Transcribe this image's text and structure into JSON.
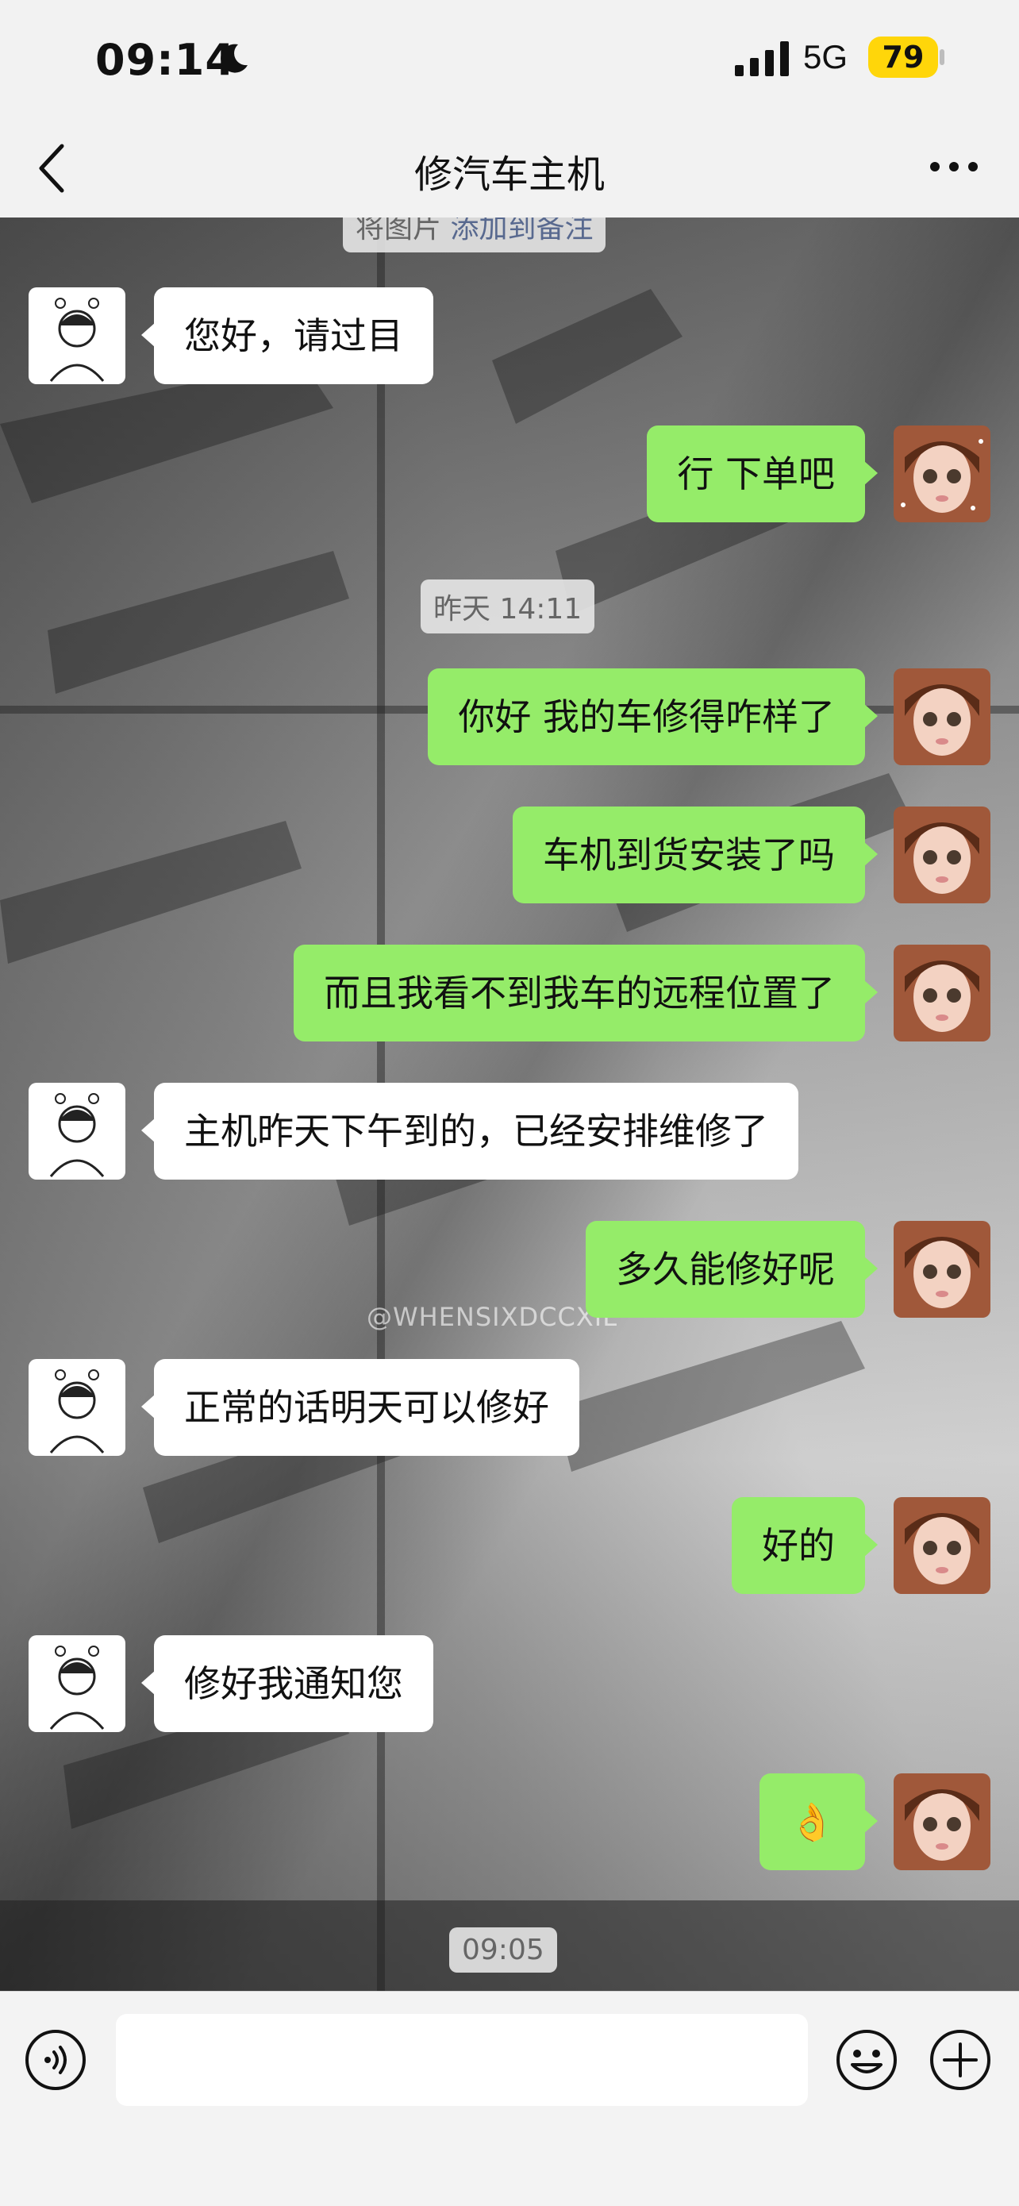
{
  "status": {
    "time": "09:14",
    "network": "5G",
    "battery": "79"
  },
  "nav": {
    "title": "修汽车主机"
  },
  "top_banner": {
    "text": "将图片",
    "link": "添加到备注"
  },
  "timestamps": [
    "昨天 14:11",
    "09:05"
  ],
  "watermark": "@WHENSIXDCCXIL",
  "messages": [
    {
      "side": "in",
      "text": "您好，请过目"
    },
    {
      "side": "out",
      "text": "行 下单吧"
    },
    {
      "side": "out",
      "text": "你好 我的车修得咋样了"
    },
    {
      "side": "out",
      "text": "车机到货安装了吗"
    },
    {
      "side": "out",
      "text": "而且我看不到我车的远程位置了"
    },
    {
      "side": "in",
      "text": "主机昨天下午到的，已经安排维修了"
    },
    {
      "side": "out",
      "text": "多久能修好呢"
    },
    {
      "side": "in",
      "text": "正常的话明天可以修好"
    },
    {
      "side": "out",
      "text": "好的"
    },
    {
      "side": "in",
      "text": "修好我通知您"
    },
    {
      "side": "out",
      "text": "👌"
    }
  ],
  "icons": {
    "back": "chevron-left-icon",
    "more": "more-dots-icon",
    "voice": "voice-icon",
    "emoji": "emoji-icon",
    "plus": "plus-icon"
  },
  "colors": {
    "outgoing": "#95ec69",
    "incoming": "#ffffff",
    "battery": "#ffd60a"
  }
}
